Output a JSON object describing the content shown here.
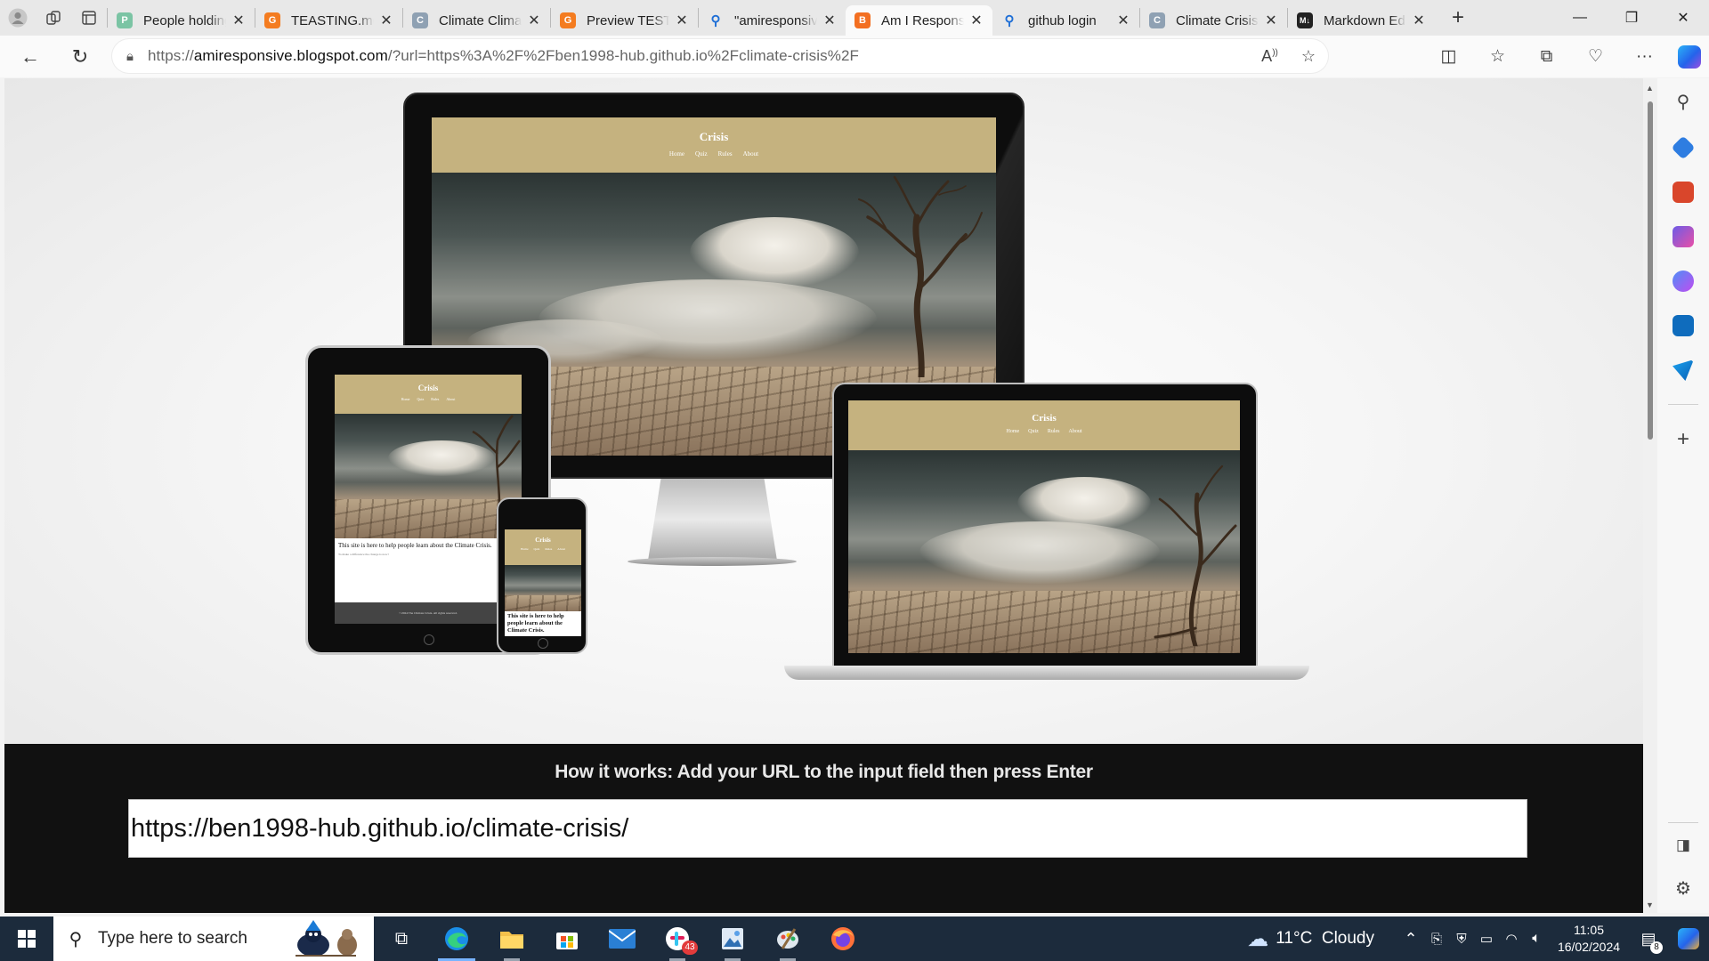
{
  "tabs": [
    {
      "title": "People holding",
      "favicon_color": "#7bc4a4",
      "active": false
    },
    {
      "title": "TEASTING.md",
      "favicon_color": "#f47c20",
      "active": false
    },
    {
      "title": "Climate Climate",
      "favicon_color": "#8fa1b3",
      "active": false
    },
    {
      "title": "Preview TEST",
      "favicon_color": "#f47c20",
      "active": false
    },
    {
      "title": "\"amiresponsive",
      "favicon_color": "#1f6fd6",
      "active": false
    },
    {
      "title": "Am I Responsive",
      "favicon_color": "#f36f21",
      "active": true
    },
    {
      "title": "github login",
      "favicon_color": "#1f6fd6",
      "active": false
    },
    {
      "title": "Climate Crisis",
      "favicon_color": "#8fa1b3",
      "active": false
    },
    {
      "title": "Markdown Editor",
      "favicon_color": "#222222",
      "active": false
    }
  ],
  "address_bar": {
    "url_prefix": "https://",
    "url_host": "amiresponsive.blogspot.com",
    "url_rest": "/?url=https%3A%2F%2Fben1998-hub.github.io%2Fclimate-crisis%2F"
  },
  "site": {
    "brand": "Crisis",
    "nav": [
      "Home",
      "Quiz",
      "Rules",
      "About"
    ],
    "intro_text": "This site is here to help people learn about the Climate Crisis.",
    "sub_text": "To make a difference the change is now!",
    "footer_text": "©2024 The Climate Crisis. All rights reserved."
  },
  "how_it_works": {
    "title": "How it works: Add your URL to the input field then press Enter",
    "input_value": "https://ben1998-hub.github.io/climate-crisis/"
  },
  "taskbar": {
    "search_placeholder": "Type here to search",
    "weather": "11°C  Cloudy",
    "time": "11:05",
    "date": "16/02/2024",
    "notification_count": "8",
    "app_badge": "43"
  }
}
